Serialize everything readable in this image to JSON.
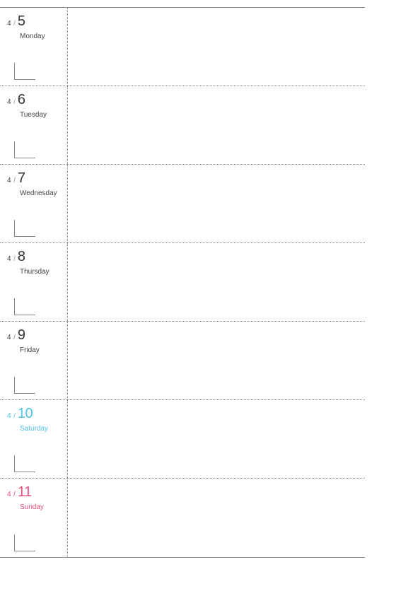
{
  "planner": {
    "days": [
      {
        "month": "4",
        "day": "5",
        "weekday": "Monday",
        "variant": ""
      },
      {
        "month": "4",
        "day": "6",
        "weekday": "Tuesday",
        "variant": ""
      },
      {
        "month": "4",
        "day": "7",
        "weekday": "Wednesday",
        "variant": ""
      },
      {
        "month": "4",
        "day": "8",
        "weekday": "Thursday",
        "variant": ""
      },
      {
        "month": "4",
        "day": "9",
        "weekday": "Friday",
        "variant": ""
      },
      {
        "month": "4",
        "day": "10",
        "weekday": "Saturday",
        "variant": "sat"
      },
      {
        "month": "4",
        "day": "11",
        "weekday": "Sunday",
        "variant": "sun"
      }
    ]
  }
}
